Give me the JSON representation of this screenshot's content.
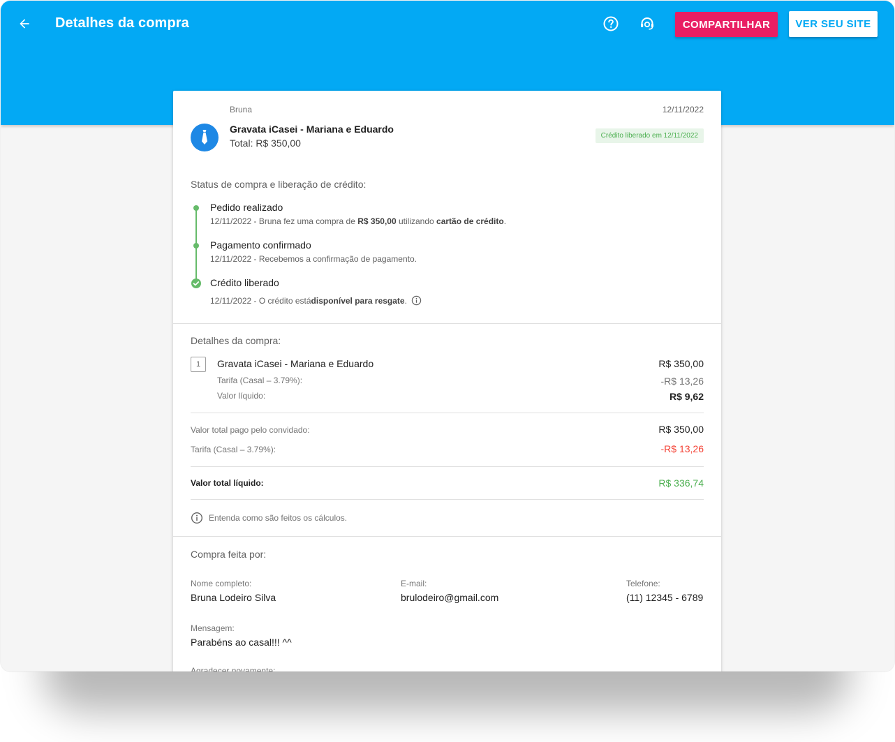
{
  "header": {
    "title": "Detalhes da compra",
    "share_label": "COMPARTILHAR",
    "site_label": "VER SEU SITE"
  },
  "purchase": {
    "buyer_first_name": "Bruna",
    "date": "12/11/2022",
    "product_name": "Gravata iCasei - Mariana e Eduardo",
    "total": "Total: R$ 350,00",
    "badge": "Crédito liberado em 12/11/2022"
  },
  "status": {
    "title": "Status de compra e liberação de crédito:",
    "steps": [
      {
        "title": "Pedido realizado",
        "desc_parts": [
          "12/11/2022 - Bruna fez uma compra de ",
          "R$ 350,00",
          " utilizando ",
          "cartão de crédito",
          "."
        ]
      },
      {
        "title": "Pagamento confirmado",
        "desc": "12/11/2022 - Recebemos a confirmação de pagamento."
      },
      {
        "title": "Crédito liberado",
        "desc_parts": [
          "12/11/2022 - O crédito está ",
          "disponível para resgate",
          "."
        ]
      }
    ]
  },
  "details": {
    "title": "Detalhes da compra:",
    "item": {
      "qty": "1",
      "name": "Gravata iCasei - Mariana e Eduardo",
      "price": "R$ 350,00",
      "fee_label": "Tarifa (Casal – 3.79%):",
      "fee_value": "-R$ 13,26",
      "net_label": "Valor líquido:",
      "net_value": "R$ 9,62"
    },
    "summary": {
      "paid_label": "Valor total pago pelo convidado:",
      "paid_value": "R$ 350,00",
      "fee_label": "Tarifa (Casal – 3.79%):",
      "fee_value": "-R$ 13,26",
      "net_label": "Valor total líquido:",
      "net_value": "R$ 336,74"
    },
    "calc_link": "Entenda como são feitos os cálculos."
  },
  "buyer": {
    "title": "Compra feita por:",
    "name_label": "Nome completo:",
    "name_value": "Bruna Lodeiro Silva",
    "email_label": "E-mail:",
    "email_value": "brulodeiro@gmail.com",
    "phone_label": "Telefone:",
    "phone_value": "(11) 12345 - 6789",
    "message_label": "Mensagem:",
    "message_value": "Parabéns ao casal!!! ^^",
    "thanks_label": "Agradecer novamente:"
  },
  "colors": {
    "primary": "#03a9f4",
    "accent": "#e91e63",
    "success": "#4caf50",
    "danger": "#f44336"
  },
  "icons": [
    "arrow-back-icon",
    "help-icon",
    "support-agent-icon",
    "tie-icon",
    "check-circle-icon",
    "info-icon"
  ]
}
